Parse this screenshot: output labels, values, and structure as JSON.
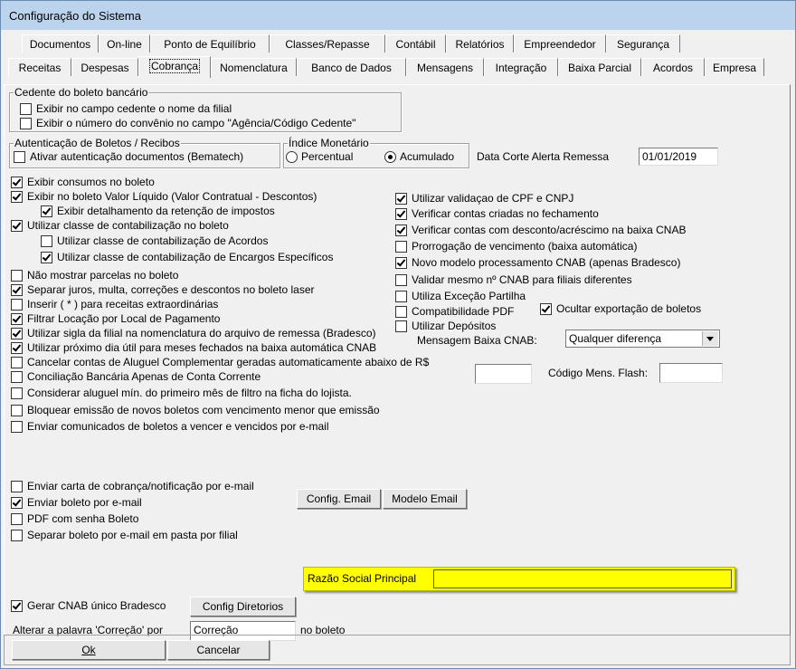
{
  "window": {
    "title": "Configuração do Sistema"
  },
  "tabs_row1": [
    "Documentos",
    "On-line",
    "Ponto de Equilíbrio",
    "Classes/Repasse",
    "Contábil",
    "Relatórios",
    "Empreendedor",
    "Segurança"
  ],
  "tabs_row2": [
    "Receitas",
    "Despesas",
    "Cobrança",
    "Nomenclatura",
    "Banco de Dados",
    "Mensagens",
    "Integração",
    "Baixa Parcial",
    "Acordos",
    "Empresa"
  ],
  "active_tab": "Cobrança",
  "cedente": {
    "label": "Cedente do boleto bancário",
    "opt1": "Exibir no campo cedente o nome da filial",
    "opt2": "Exibir o número do convênio no campo \"Agência/Código Cedente\""
  },
  "autenticacao": {
    "label": "Autenticação de Boletos / Recibos",
    "opt1": "Ativar autenticação documentos (Bematech)"
  },
  "indice": {
    "label": "Índice Monetário",
    "opt_percentual": "Percentual",
    "opt_acumulado": "Acumulado",
    "selected": "Acumulado"
  },
  "data_corte": {
    "label": "Data Corte Alerta Remessa",
    "value": "01/01/2019"
  },
  "left_checks": {
    "c1": "Exibir consumos no boleto",
    "c2": "Exibir no boleto Valor Líquido (Valor Contratual - Descontos)",
    "c3": "Exibir detalhamento da retenção de impostos",
    "c4": "Utilizar classe de contabilização no boleto",
    "c5": "Utilizar classe de contabilização de Acordos",
    "c6": "Utilizar classe de contabilização de Encargos Específicos",
    "c7": "Não mostrar parcelas no boleto",
    "c8": "Separar juros, multa, correções e descontos no boleto laser",
    "c9": "Inserir ( * ) para receitas extraordinárias",
    "c10": "Filtrar Locação por Local de Pagamento",
    "c11": "Utilizar sigla da filial na nomenclatura do arquivo de remessa (Bradesco)",
    "c12": "Utilizar próximo dia útil para meses fechados na baixa automática CNAB",
    "c13": "Cancelar contas de Aluguel Complementar geradas automaticamente abaixo de R$",
    "c14": "Conciliação Bancária Apenas de Conta Corrente",
    "c15": "Considerar aluguel mín. do primeiro mês de filtro na ficha do lojista.",
    "c16": "Bloquear emissão de novos boletos com vencimento menor que emissão",
    "c17": "Enviar comunicados de boletos a vencer e vencidos por e-mail"
  },
  "right_checks": {
    "r1": "Utilizar validaçao de CPF e CNPJ",
    "r2": "Verificar contas criadas no fechamento",
    "r3": "Verificar contas com desconto/acréscimo na baixa CNAB",
    "r4": "Prorrogação de vencimento (baixa automática)",
    "r5": "Novo modelo processamento CNAB (apenas Bradesco)",
    "r6": "Validar mesmo nº CNAB para filiais diferentes",
    "r7": "Utiliza Exceção Partilha",
    "r8": "Compatibilidade PDF",
    "r9": "Ocultar exportação de boletos",
    "r10": "Utilizar Depósitos"
  },
  "mensagem_baixa": {
    "label": "Mensagem Baixa CNAB:",
    "value": "Qualquer diferença"
  },
  "codigo_flash": {
    "label": "Código Mens. Flash:",
    "value": ""
  },
  "email": {
    "e1": "Enviar carta de cobrança/notificação por e-mail",
    "e2": "Enviar boleto por e-mail",
    "e3": "PDF com senha Boleto",
    "e4": "Separar boleto por e-mail em pasta por filial",
    "btn_config": "Config. Email",
    "btn_modelo": "Modelo Email"
  },
  "cnab": {
    "label": "Gerar CNAB único Bradesco",
    "btn_dir": "Config Diretorios",
    "razao_label": "Razão Social Principal",
    "razao_value": ""
  },
  "correcao": {
    "label": "Alterar a palavra 'Correção' por",
    "value": "Correção",
    "suffix": "no boleto"
  },
  "footer": {
    "ok": "Ok",
    "cancel": "Cancelar"
  }
}
